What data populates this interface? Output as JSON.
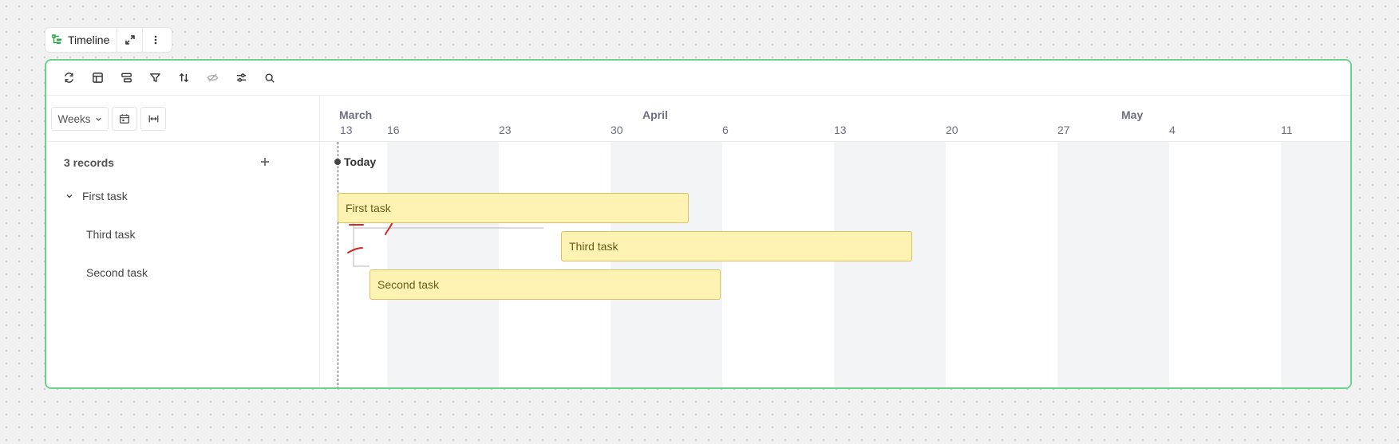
{
  "widget": {
    "title": "Timeline",
    "icons": [
      "timeline-icon",
      "expand-icon",
      "more-vertical-icon"
    ]
  },
  "toolbar": {
    "icons": [
      "refresh-icon",
      "layout-icon",
      "group-icon",
      "filter-icon",
      "sort-icon",
      "hide-fields-icon",
      "settings-sliders-icon",
      "search-icon"
    ]
  },
  "controls": {
    "scale_label": "Weeks",
    "scale_icon": "chevron-down-icon",
    "calendar_icon": "calendar-icon",
    "fit_icon": "fit-width-icon"
  },
  "records": {
    "count_label": "3 records",
    "add_icon": "plus-icon",
    "items": [
      {
        "label": "First task",
        "expanded": true
      },
      {
        "label": "Third task"
      },
      {
        "label": "Second task"
      }
    ]
  },
  "timeline": {
    "months": [
      "March",
      "April",
      "May"
    ],
    "days": [
      "13",
      "16",
      "23",
      "30",
      "6",
      "13",
      "20",
      "27",
      "4",
      "11"
    ],
    "today_label": "Today",
    "bars": [
      {
        "label": "First task"
      },
      {
        "label": "Third task"
      },
      {
        "label": "Second task"
      }
    ]
  },
  "colors": {
    "accent_border": "#6ed08a",
    "bar_fill": "#fff3b3",
    "bar_border": "#d9c060",
    "annotation": "#d12a2a"
  }
}
